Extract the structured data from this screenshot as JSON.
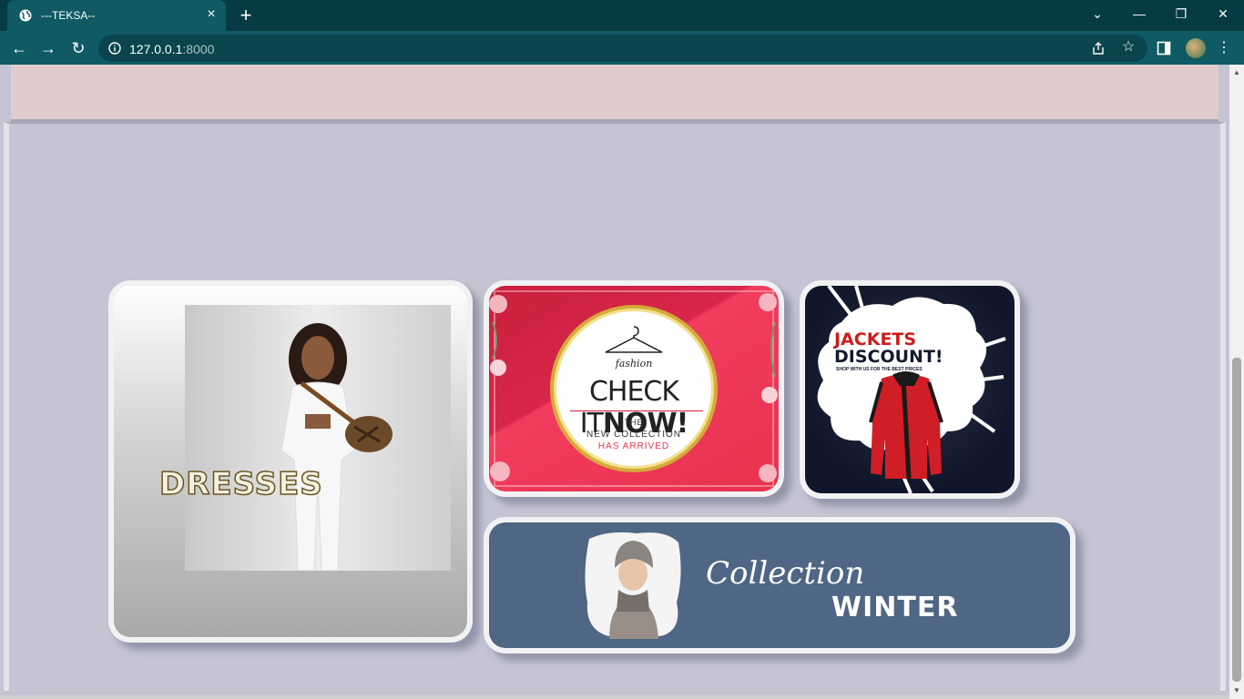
{
  "browser": {
    "tab": {
      "title": "---TEKSA--",
      "favicon": "globe-icon",
      "close": "×"
    },
    "new_tab": "+",
    "window_controls": {
      "dropdown": "⌄",
      "minimize": "—",
      "restore": "❐",
      "close": "✕"
    },
    "nav": {
      "back": "←",
      "forward": "→",
      "reload": "↻"
    },
    "address": {
      "host": "127.0.0.1",
      "port": ":8000"
    },
    "star": "☆",
    "menu": "⋮"
  },
  "page": {
    "colors": {
      "background": "#c4c4d4",
      "band": "#e0cccd",
      "winter": "#4f6684",
      "checkit": "#e9324f"
    },
    "cards": {
      "dresses": {
        "label": "DRESSES"
      },
      "checkit": {
        "brand": "fashion",
        "headline_light": "CHECK IT",
        "headline_bold": "NOW!",
        "line1": "THE",
        "line2": "NEW COLLECTION",
        "line3": "HAS ARRIVED"
      },
      "jackets": {
        "title1": "JACKETS",
        "title2": "DISCOUNT!",
        "subtitle": "SHOP WITH US FOR THE BEST PRICES"
      },
      "winter": {
        "script": "Collection",
        "word": "WINTER"
      }
    }
  },
  "scrollbar": {
    "up": "▲",
    "down": "▼"
  }
}
